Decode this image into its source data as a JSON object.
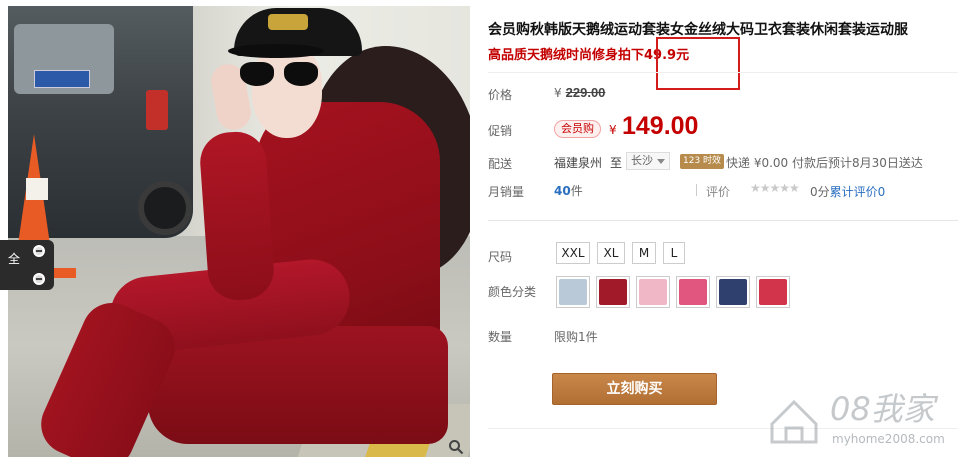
{
  "product": {
    "title": "会员购秋韩版天鹅绒运动套装女金丝绒大码卫衣套装休闲套装运动服",
    "subtitle": "高品质天鹅绒时尚修身拍下49.9元"
  },
  "gallery": {
    "side_label": "全"
  },
  "pricing": {
    "price_label": "价格",
    "currency": "¥",
    "original_price": "229.00",
    "promo_label": "促销",
    "member_badge": "会员购",
    "promo_price": "149.00"
  },
  "shipping": {
    "label": "配送",
    "from": "福建泉州",
    "to_word": "至",
    "destination": "长沙",
    "badge": "123 时效",
    "detail": "快递 ¥0.00 付款后预计8月30日送达"
  },
  "sales": {
    "label": "月销量",
    "count": "40",
    "unit": "件",
    "review_label": "评价",
    "stars": "★★★★★",
    "score": "0分",
    "review_link": "累计评价0"
  },
  "sku": {
    "size_label": "尺码",
    "sizes": [
      "XXL",
      "XL",
      "M",
      "L"
    ],
    "color_label": "颜色分类",
    "colors": [
      "#b9c9d8",
      "#a11a2a",
      "#f0b7c6",
      "#e1567f",
      "#2f3f6e",
      "#d2344b"
    ]
  },
  "quantity": {
    "label": "数量",
    "value": "限购1件"
  },
  "actions": {
    "buy_now": "立刻购买"
  },
  "watermark": {
    "brand": "08我家",
    "url": "myhome2008.com"
  }
}
